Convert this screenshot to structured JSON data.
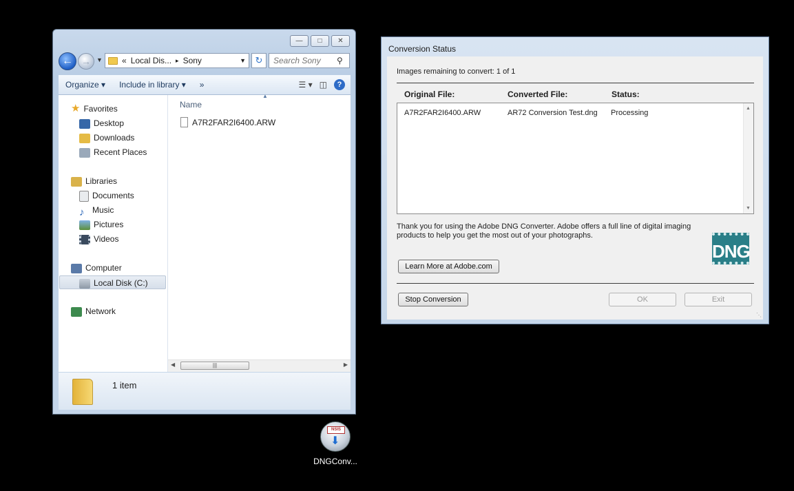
{
  "explorer": {
    "address": {
      "chevron": "«",
      "crumb1": "Local Dis...",
      "separator": "▸",
      "crumb2": "Sony"
    },
    "search_placeholder": "Search Sony",
    "toolbar": {
      "organize": "Organize ▾",
      "include": "Include in library ▾",
      "more": "»"
    },
    "nav": {
      "favorites": "Favorites",
      "desktop": "Desktop",
      "downloads": "Downloads",
      "recent": "Recent Places",
      "libraries": "Libraries",
      "documents": "Documents",
      "music": "Music",
      "pictures": "Pictures",
      "videos": "Videos",
      "computer": "Computer",
      "local_disk": "Local Disk (C:)",
      "network": "Network"
    },
    "column_name": "Name",
    "files": [
      {
        "name": "A7R2FAR2I6400.ARW"
      }
    ],
    "status_count": "1 item"
  },
  "dialog": {
    "title": "Conversion Status",
    "remaining": "Images remaining to convert: 1 of 1",
    "headers": {
      "original": "Original File:",
      "converted": "Converted File:",
      "status": "Status:"
    },
    "rows": [
      {
        "original": "A7R2FAR2I6400.ARW",
        "converted": "AR72 Conversion Test.dng",
        "status": "Processing"
      }
    ],
    "message": "Thank you for using the Adobe DNG Converter.  Adobe offers a full line of digital imaging products to help you get the most out of your photographs.",
    "logo_text": "DNG",
    "buttons": {
      "learn_more": "Learn More at Adobe.com",
      "stop": "Stop Conversion",
      "ok": "OK",
      "exit": "Exit"
    }
  },
  "desktop": {
    "icon_label": "DNGConv...",
    "icon_badge": "NSIS"
  }
}
